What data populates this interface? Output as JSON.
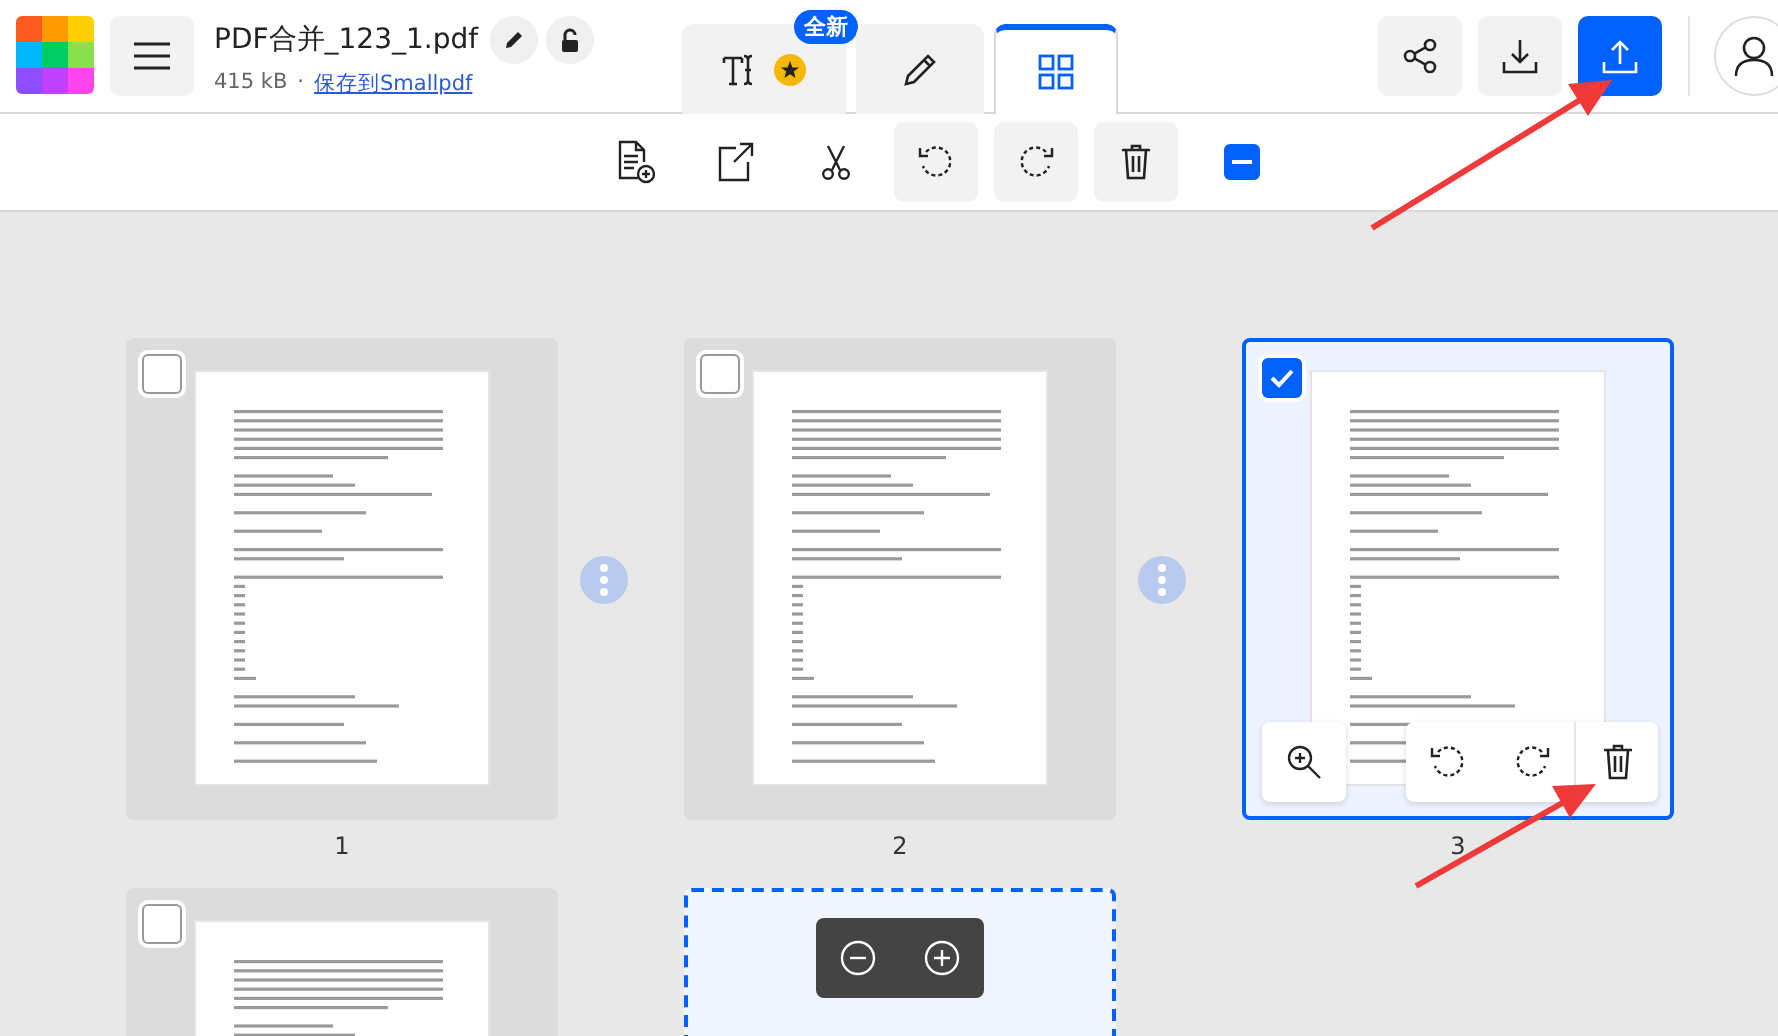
{
  "file": {
    "name": "PDF合并_123_1.pdf",
    "size": "415 kB",
    "separator": "·",
    "save_link": "保存到Smallpdf"
  },
  "tabs": [
    {
      "kind": "text",
      "badge": "全新",
      "selected": false
    },
    {
      "kind": "edit",
      "selected": false
    },
    {
      "kind": "grid",
      "selected": true
    }
  ],
  "actions": [
    {
      "kind": "share"
    },
    {
      "kind": "download"
    },
    {
      "kind": "export"
    }
  ],
  "toolbar": [
    {
      "kind": "add-page"
    },
    {
      "kind": "extract"
    },
    {
      "kind": "split"
    },
    {
      "kind": "rotate-left"
    },
    {
      "kind": "rotate-right"
    },
    {
      "kind": "delete"
    },
    {
      "kind": "deselect",
      "partial": true
    }
  ],
  "pages": [
    {
      "label": "1",
      "selected": false,
      "actions_shown": false
    },
    {
      "label": "2",
      "selected": false,
      "actions_shown": false
    },
    {
      "label": "3",
      "selected": true,
      "actions_shown": true
    },
    {
      "selected": false
    }
  ]
}
